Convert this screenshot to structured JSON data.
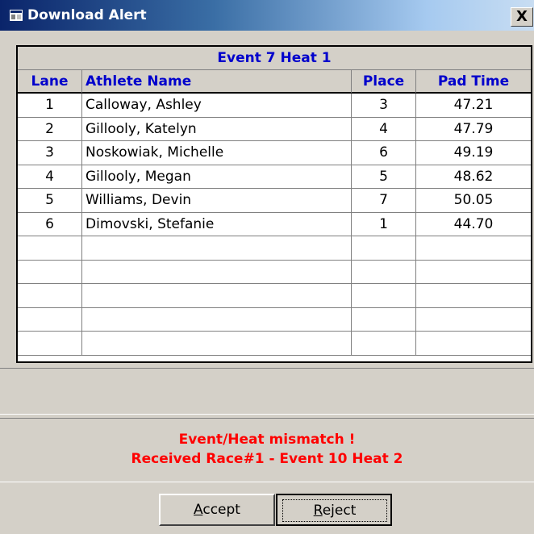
{
  "window": {
    "title": "Download Alert",
    "close_label": "X",
    "icon": "window-app-icon"
  },
  "grid": {
    "event_title": "Event 7 Heat 1",
    "columns": [
      "Lane",
      "Athlete Name",
      "Place",
      "Pad Time"
    ],
    "rows": [
      {
        "lane": "1",
        "name": "Calloway, Ashley",
        "place": "3",
        "time": "47.21"
      },
      {
        "lane": "2",
        "name": "Gillooly, Katelyn",
        "place": "4",
        "time": "47.79"
      },
      {
        "lane": "3",
        "name": "Noskowiak, Michelle",
        "place": "6",
        "time": "49.19"
      },
      {
        "lane": "4",
        "name": "Gillooly, Megan",
        "place": "5",
        "time": "48.62"
      },
      {
        "lane": "5",
        "name": "Williams, Devin",
        "place": "7",
        "time": "50.05"
      },
      {
        "lane": "6",
        "name": "Dimovski, Stefanie",
        "place": "1",
        "time": "44.70"
      },
      {
        "lane": "",
        "name": "",
        "place": "",
        "time": ""
      },
      {
        "lane": "",
        "name": "",
        "place": "",
        "time": ""
      },
      {
        "lane": "",
        "name": "",
        "place": "",
        "time": ""
      },
      {
        "lane": "",
        "name": "",
        "place": "",
        "time": ""
      },
      {
        "lane": "",
        "name": "",
        "place": "",
        "time": ""
      }
    ]
  },
  "message": {
    "line1": "Event/Heat mismatch !",
    "line2": "Received Race#1 - Event 10 Heat 2"
  },
  "buttons": {
    "accept_first": "A",
    "accept_rest": "ccept",
    "reject_first": "R",
    "reject_rest": "eject"
  },
  "colors": {
    "header_text": "#0000cc",
    "alert_text": "#ff0000",
    "titlebar_start": "#0a246a",
    "face": "#d4d0c8"
  }
}
